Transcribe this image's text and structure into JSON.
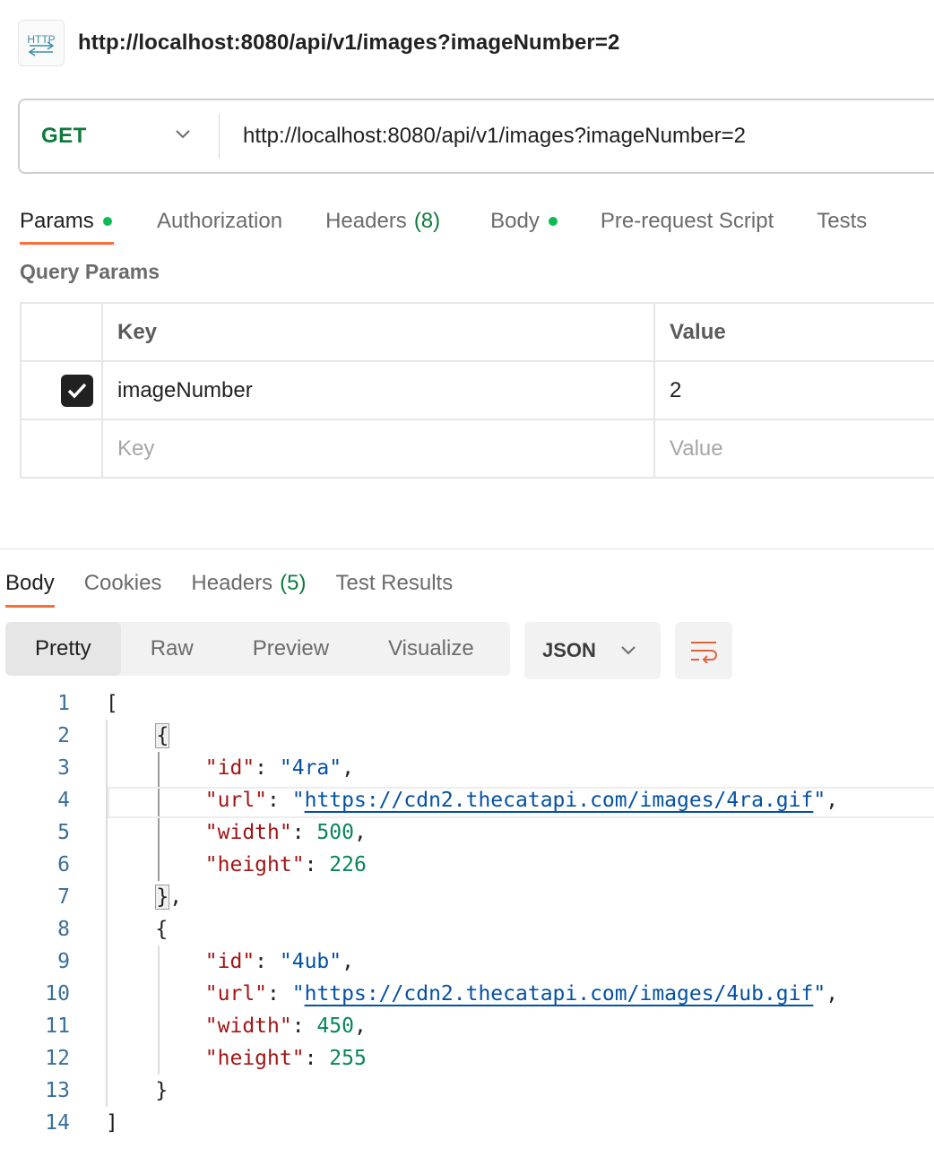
{
  "request": {
    "title": "http://localhost:8080/api/v1/images?imageNumber=2",
    "icon": "http-icon",
    "method": "GET",
    "url": "http://localhost:8080/api/v1/images?imageNumber=2"
  },
  "request_tabs": [
    {
      "label": "Params",
      "dot": true,
      "active": true
    },
    {
      "label": "Authorization"
    },
    {
      "label": "Headers",
      "count": "(8)"
    },
    {
      "label": "Body",
      "dot": true
    },
    {
      "label": "Pre-request Script"
    },
    {
      "label": "Tests"
    }
  ],
  "query_params": {
    "title": "Query Params",
    "headers": {
      "key": "Key",
      "value": "Value"
    },
    "rows": [
      {
        "checked": true,
        "key": "imageNumber",
        "value": "2"
      }
    ],
    "placeholder": {
      "key": "Key",
      "value": "Value"
    }
  },
  "response_tabs": [
    {
      "label": "Body",
      "active": true
    },
    {
      "label": "Cookies"
    },
    {
      "label": "Headers",
      "count": "(5)"
    },
    {
      "label": "Test Results"
    }
  ],
  "view_modes": [
    "Pretty",
    "Raw",
    "Preview",
    "Visualize"
  ],
  "active_view": "Pretty",
  "format": "JSON",
  "colors": {
    "accent": "#ff6c37",
    "method": "#0f7b3d",
    "dot": "#0cbb52"
  },
  "response_body": {
    "line_numbers": [
      "1",
      "2",
      "3",
      "4",
      "5",
      "6",
      "7",
      "8",
      "9",
      "10",
      "11",
      "12",
      "13",
      "14"
    ],
    "items": [
      {
        "id": "4ra",
        "url": "https://cdn2.thecatapi.com/images/4ra.gif",
        "width": "500",
        "height": "226"
      },
      {
        "id": "4ub",
        "url": "https://cdn2.thecatapi.com/images/4ub.gif",
        "width": "450",
        "height": "255"
      }
    ]
  }
}
